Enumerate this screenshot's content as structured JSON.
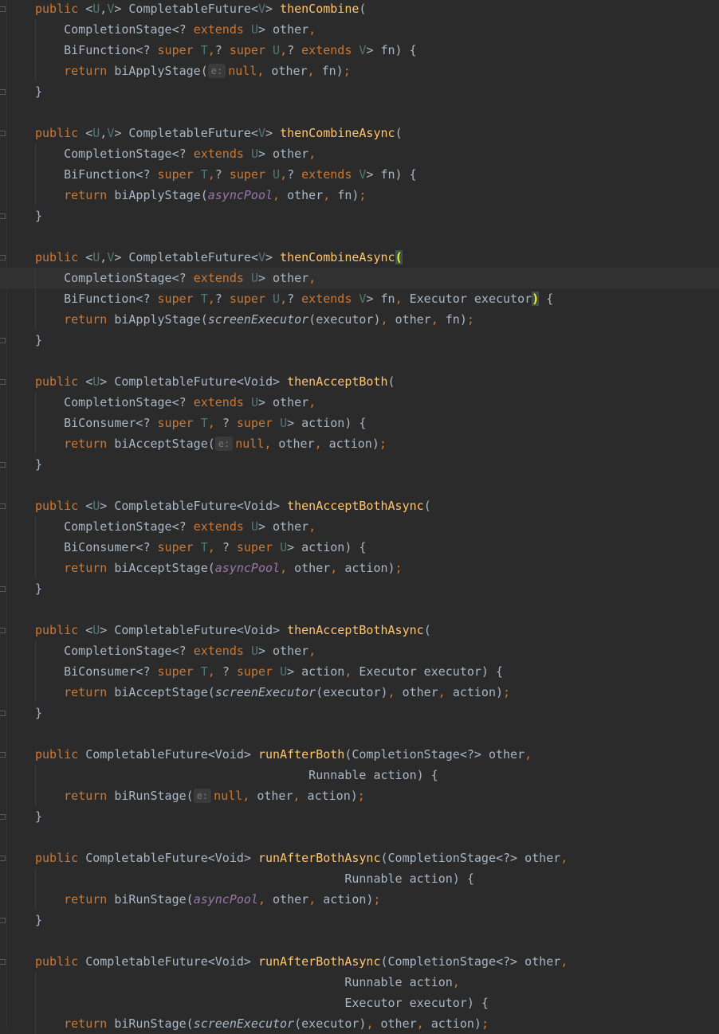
{
  "editor": {
    "theme_colors": {
      "background": "#2b2b2b",
      "keyword": "#cc7832",
      "method_declaration": "#ffc66d",
      "type_parameter": "#507874",
      "static_field": "#9876aa",
      "default_text": "#a9b7c6",
      "matched_brace": "#ffef28"
    },
    "caret_line": 13,
    "inlay_hint_label": "e:",
    "lines": [
      [
        [
          "kw",
          "public "
        ],
        [
          "",
          "<"
        ],
        [
          "tp",
          "U"
        ],
        [
          "",
          ","
        ],
        [
          "tp",
          "V"
        ],
        [
          "",
          "> CompletableFuture<"
        ],
        [
          "tp",
          "V"
        ],
        [
          "",
          "> "
        ],
        [
          "fn",
          "thenCombine"
        ],
        [
          "",
          "("
        ]
      ],
      [
        [
          "",
          "    CompletionStage<? "
        ],
        [
          "kw",
          "extends "
        ],
        [
          "tp",
          "U"
        ],
        [
          "",
          "> other"
        ],
        [
          "kw",
          ","
        ]
      ],
      [
        [
          "",
          "    BiFunction<? "
        ],
        [
          "kw",
          "super "
        ],
        [
          "tp",
          "T"
        ],
        [
          "kw",
          ","
        ],
        [
          "",
          "? "
        ],
        [
          "kw",
          "super "
        ],
        [
          "tp",
          "U"
        ],
        [
          "kw",
          ","
        ],
        [
          "",
          "? "
        ],
        [
          "kw",
          "extends "
        ],
        [
          "tp",
          "V"
        ],
        [
          "",
          "> fn) {"
        ]
      ],
      [
        [
          "",
          "    "
        ],
        [
          "kw",
          "return "
        ],
        [
          "",
          "biApplyStage("
        ],
        [
          "hint",
          "e:"
        ],
        [
          "kw",
          "null"
        ],
        [
          "kw",
          ", "
        ],
        [
          "",
          "other"
        ],
        [
          "kw",
          ", "
        ],
        [
          "",
          "fn)"
        ],
        [
          "kw",
          ";"
        ]
      ],
      [
        [
          "",
          "}"
        ]
      ],
      [],
      [
        [
          "kw",
          "public "
        ],
        [
          "",
          "<"
        ],
        [
          "tp",
          "U"
        ],
        [
          "",
          ","
        ],
        [
          "tp",
          "V"
        ],
        [
          "",
          "> CompletableFuture<"
        ],
        [
          "tp",
          "V"
        ],
        [
          "",
          "> "
        ],
        [
          "fn",
          "thenCombineAsync"
        ],
        [
          "",
          "("
        ]
      ],
      [
        [
          "",
          "    CompletionStage<? "
        ],
        [
          "kw",
          "extends "
        ],
        [
          "tp",
          "U"
        ],
        [
          "",
          "> other"
        ],
        [
          "kw",
          ","
        ]
      ],
      [
        [
          "",
          "    BiFunction<? "
        ],
        [
          "kw",
          "super "
        ],
        [
          "tp",
          "T"
        ],
        [
          "kw",
          ","
        ],
        [
          "",
          "? "
        ],
        [
          "kw",
          "super "
        ],
        [
          "tp",
          "U"
        ],
        [
          "kw",
          ","
        ],
        [
          "",
          "? "
        ],
        [
          "kw",
          "extends "
        ],
        [
          "tp",
          "V"
        ],
        [
          "",
          "> fn) {"
        ]
      ],
      [
        [
          "",
          "    "
        ],
        [
          "kw",
          "return "
        ],
        [
          "",
          "biApplyStage("
        ],
        [
          "fld",
          "asyncPool"
        ],
        [
          "kw",
          ", "
        ],
        [
          "",
          "other"
        ],
        [
          "kw",
          ", "
        ],
        [
          "",
          "fn)"
        ],
        [
          "kw",
          ";"
        ]
      ],
      [
        [
          "",
          "}"
        ]
      ],
      [],
      [
        [
          "kw",
          "public "
        ],
        [
          "",
          "<"
        ],
        [
          "tp",
          "U"
        ],
        [
          "",
          ","
        ],
        [
          "tp",
          "V"
        ],
        [
          "",
          "> CompletableFuture<"
        ],
        [
          "tp",
          "V"
        ],
        [
          "",
          "> "
        ],
        [
          "fn",
          "thenCombineAsync"
        ],
        [
          "brace-hl",
          "("
        ]
      ],
      [
        [
          "",
          "    CompletionStage<? "
        ],
        [
          "kw",
          "extends "
        ],
        [
          "tp",
          "U"
        ],
        [
          "",
          "> other"
        ],
        [
          "kw",
          ","
        ]
      ],
      [
        [
          "",
          "    BiFunction<? "
        ],
        [
          "kw",
          "super "
        ],
        [
          "tp",
          "T"
        ],
        [
          "kw",
          ","
        ],
        [
          "",
          "? "
        ],
        [
          "kw",
          "super "
        ],
        [
          "tp",
          "U"
        ],
        [
          "kw",
          ","
        ],
        [
          "",
          "? "
        ],
        [
          "kw",
          "extends "
        ],
        [
          "tp",
          "V"
        ],
        [
          "",
          "> fn"
        ],
        [
          "kw",
          ", "
        ],
        [
          "",
          "Executor executor"
        ],
        [
          "brace-hl",
          ")"
        ],
        [
          "",
          " {"
        ]
      ],
      [
        [
          "",
          "    "
        ],
        [
          "kw",
          "return "
        ],
        [
          "",
          "biApplyStage("
        ],
        [
          "ist",
          "screenExecutor"
        ],
        [
          "",
          "(executor)"
        ],
        [
          "kw",
          ", "
        ],
        [
          "",
          "other"
        ],
        [
          "kw",
          ", "
        ],
        [
          "",
          "fn)"
        ],
        [
          "kw",
          ";"
        ]
      ],
      [
        [
          "",
          "}"
        ]
      ],
      [],
      [
        [
          "kw",
          "public "
        ],
        [
          "",
          "<"
        ],
        [
          "tp",
          "U"
        ],
        [
          "",
          "> CompletableFuture<Void> "
        ],
        [
          "fn",
          "thenAcceptBoth"
        ],
        [
          "",
          "("
        ]
      ],
      [
        [
          "",
          "    CompletionStage<? "
        ],
        [
          "kw",
          "extends "
        ],
        [
          "tp",
          "U"
        ],
        [
          "",
          "> other"
        ],
        [
          "kw",
          ","
        ]
      ],
      [
        [
          "",
          "    BiConsumer<? "
        ],
        [
          "kw",
          "super "
        ],
        [
          "tp",
          "T"
        ],
        [
          "kw",
          ", "
        ],
        [
          "",
          "? "
        ],
        [
          "kw",
          "super "
        ],
        [
          "tp",
          "U"
        ],
        [
          "",
          "> action) {"
        ]
      ],
      [
        [
          "",
          "    "
        ],
        [
          "kw",
          "return "
        ],
        [
          "",
          "biAcceptStage("
        ],
        [
          "hint",
          "e:"
        ],
        [
          "kw",
          "null"
        ],
        [
          "kw",
          ", "
        ],
        [
          "",
          "other"
        ],
        [
          "kw",
          ", "
        ],
        [
          "",
          "action)"
        ],
        [
          "kw",
          ";"
        ]
      ],
      [
        [
          "",
          "}"
        ]
      ],
      [],
      [
        [
          "kw",
          "public "
        ],
        [
          "",
          "<"
        ],
        [
          "tp",
          "U"
        ],
        [
          "",
          "> CompletableFuture<Void> "
        ],
        [
          "fn",
          "thenAcceptBothAsync"
        ],
        [
          "",
          "("
        ]
      ],
      [
        [
          "",
          "    CompletionStage<? "
        ],
        [
          "kw",
          "extends "
        ],
        [
          "tp",
          "U"
        ],
        [
          "",
          "> other"
        ],
        [
          "kw",
          ","
        ]
      ],
      [
        [
          "",
          "    BiConsumer<? "
        ],
        [
          "kw",
          "super "
        ],
        [
          "tp",
          "T"
        ],
        [
          "kw",
          ", "
        ],
        [
          "",
          "? "
        ],
        [
          "kw",
          "super "
        ],
        [
          "tp",
          "U"
        ],
        [
          "",
          "> action) {"
        ]
      ],
      [
        [
          "",
          "    "
        ],
        [
          "kw",
          "return "
        ],
        [
          "",
          "biAcceptStage("
        ],
        [
          "fld",
          "asyncPool"
        ],
        [
          "kw",
          ", "
        ],
        [
          "",
          "other"
        ],
        [
          "kw",
          ", "
        ],
        [
          "",
          "action)"
        ],
        [
          "kw",
          ";"
        ]
      ],
      [
        [
          "",
          "}"
        ]
      ],
      [],
      [
        [
          "kw",
          "public "
        ],
        [
          "",
          "<"
        ],
        [
          "tp",
          "U"
        ],
        [
          "",
          "> CompletableFuture<Void> "
        ],
        [
          "fn",
          "thenAcceptBothAsync"
        ],
        [
          "",
          "("
        ]
      ],
      [
        [
          "",
          "    CompletionStage<? "
        ],
        [
          "kw",
          "extends "
        ],
        [
          "tp",
          "U"
        ],
        [
          "",
          "> other"
        ],
        [
          "kw",
          ","
        ]
      ],
      [
        [
          "",
          "    BiConsumer<? "
        ],
        [
          "kw",
          "super "
        ],
        [
          "tp",
          "T"
        ],
        [
          "kw",
          ", "
        ],
        [
          "",
          "? "
        ],
        [
          "kw",
          "super "
        ],
        [
          "tp",
          "U"
        ],
        [
          "",
          "> action"
        ],
        [
          "kw",
          ", "
        ],
        [
          "",
          "Executor executor) {"
        ]
      ],
      [
        [
          "",
          "    "
        ],
        [
          "kw",
          "return "
        ],
        [
          "",
          "biAcceptStage("
        ],
        [
          "ist",
          "screenExecutor"
        ],
        [
          "",
          "(executor)"
        ],
        [
          "kw",
          ", "
        ],
        [
          "",
          "other"
        ],
        [
          "kw",
          ", "
        ],
        [
          "",
          "action)"
        ],
        [
          "kw",
          ";"
        ]
      ],
      [
        [
          "",
          "}"
        ]
      ],
      [],
      [
        [
          "kw",
          "public "
        ],
        [
          "",
          "CompletableFuture<Void> "
        ],
        [
          "fn",
          "runAfterBoth"
        ],
        [
          "",
          "(CompletionStage<?> other"
        ],
        [
          "kw",
          ","
        ]
      ],
      [
        [
          "",
          "                                      Runnable action) {"
        ]
      ],
      [
        [
          "",
          "    "
        ],
        [
          "kw",
          "return "
        ],
        [
          "",
          "biRunStage("
        ],
        [
          "hint",
          "e:"
        ],
        [
          "kw",
          "null"
        ],
        [
          "kw",
          ", "
        ],
        [
          "",
          "other"
        ],
        [
          "kw",
          ", "
        ],
        [
          "",
          "action)"
        ],
        [
          "kw",
          ";"
        ]
      ],
      [
        [
          "",
          "}"
        ]
      ],
      [],
      [
        [
          "kw",
          "public "
        ],
        [
          "",
          "CompletableFuture<Void> "
        ],
        [
          "fn",
          "runAfterBothAsync"
        ],
        [
          "",
          "(CompletionStage<?> other"
        ],
        [
          "kw",
          ","
        ]
      ],
      [
        [
          "",
          "                                           Runnable action) {"
        ]
      ],
      [
        [
          "",
          "    "
        ],
        [
          "kw",
          "return "
        ],
        [
          "",
          "biRunStage("
        ],
        [
          "fld",
          "asyncPool"
        ],
        [
          "kw",
          ", "
        ],
        [
          "",
          "other"
        ],
        [
          "kw",
          ", "
        ],
        [
          "",
          "action)"
        ],
        [
          "kw",
          ";"
        ]
      ],
      [
        [
          "",
          "}"
        ]
      ],
      [],
      [
        [
          "kw",
          "public "
        ],
        [
          "",
          "CompletableFuture<Void> "
        ],
        [
          "fn",
          "runAfterBothAsync"
        ],
        [
          "",
          "(CompletionStage<?> other"
        ],
        [
          "kw",
          ","
        ]
      ],
      [
        [
          "",
          "                                           Runnable action"
        ],
        [
          "kw",
          ","
        ]
      ],
      [
        [
          "",
          "                                           Executor executor) {"
        ]
      ],
      [
        [
          "",
          "    "
        ],
        [
          "kw",
          "return "
        ],
        [
          "",
          "biRunStage("
        ],
        [
          "ist",
          "screenExecutor"
        ],
        [
          "",
          "(executor)"
        ],
        [
          "kw",
          ", "
        ],
        [
          "",
          "other"
        ],
        [
          "kw",
          ", "
        ],
        [
          "",
          "action)"
        ],
        [
          "kw",
          ";"
        ]
      ]
    ]
  }
}
